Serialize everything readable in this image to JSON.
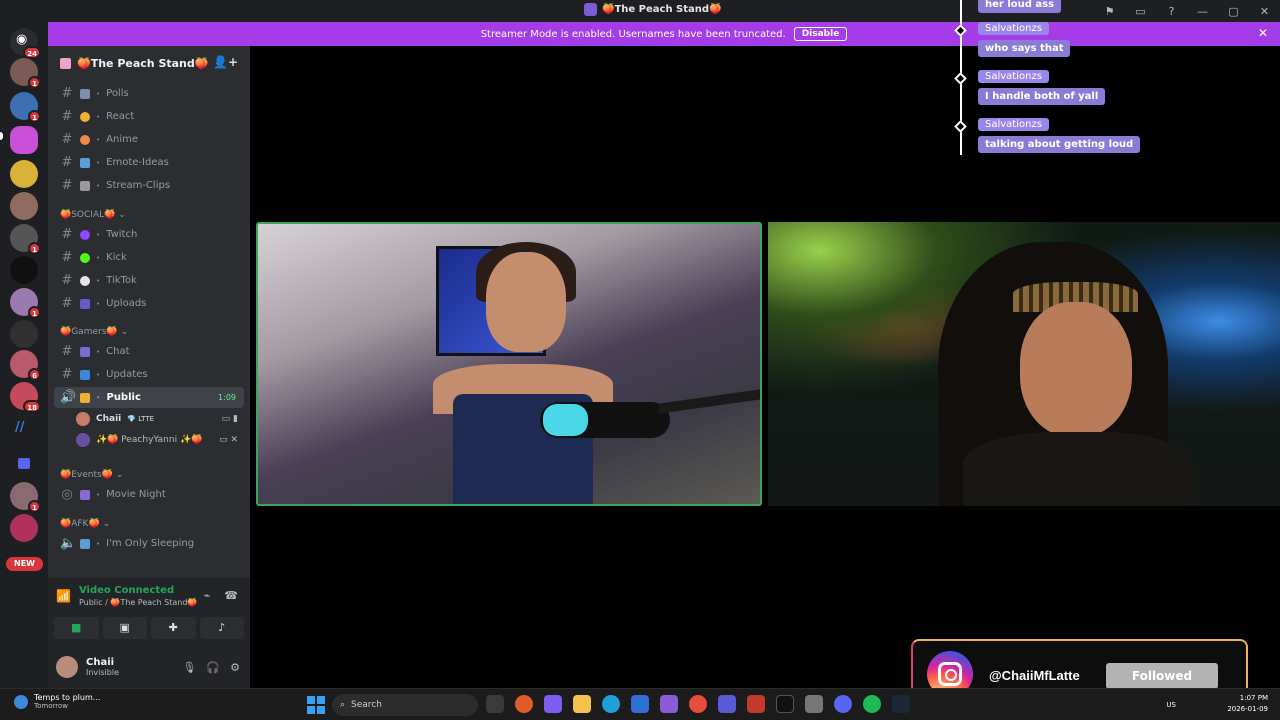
{
  "window": {
    "title": "🍑The Peach Stand🍑"
  },
  "banner": {
    "text": "Streamer Mode is enabled. Usernames have been truncated.",
    "disable_label": "Disable"
  },
  "rail": {
    "home_badge": "24",
    "badges": [
      "1",
      "1",
      "1",
      "1",
      "1",
      "6",
      "18",
      "1"
    ],
    "new_label": "NEW"
  },
  "guild": {
    "name": "🍑The Peach Stand🍑"
  },
  "channels_top": [
    {
      "name": "Polls"
    },
    {
      "name": "React"
    },
    {
      "name": "Anime"
    },
    {
      "name": "Emote-Ideas"
    },
    {
      "name": "Stream-Clips"
    }
  ],
  "categories": {
    "social": "🍑SOCIAL🍑",
    "gamers": "🍑Gamers🍑",
    "events": "🍑Events🍑",
    "afk": "🍑AFK🍑"
  },
  "channels_social": [
    {
      "name": "Twitch"
    },
    {
      "name": "Kick"
    },
    {
      "name": "TikTok"
    },
    {
      "name": "Uploads"
    }
  ],
  "channels_gamers": [
    {
      "name": "Chat"
    },
    {
      "name": "Updates"
    }
  ],
  "voice_public": {
    "name": "Public",
    "time": "1:09",
    "users": [
      {
        "name": "Chaii",
        "tag": "💎 LTTE"
      },
      {
        "name": "✨🍑 PeachyYanni ✨🍑",
        "tag": ""
      }
    ]
  },
  "events_channel": "Movie Night",
  "afk_channel": "I'm Only Sleeping",
  "voice_panel": {
    "status": "Video Connected",
    "location": "Public / 🍑The Peach Stand🍑"
  },
  "user_panel": {
    "name": "Chaii",
    "status": "Invisible"
  },
  "chat_overlay": [
    {
      "user": "",
      "text": "her loud ass"
    },
    {
      "user": "Salvationzs",
      "text": "who says that"
    },
    {
      "user": "Salvationzs",
      "text": "I handle both of yall"
    },
    {
      "user": "Salvationzs",
      "text": "talking about getting loud"
    }
  ],
  "instagram_card": {
    "handle": "@ChaiiMfLatte",
    "button": "Followed"
  },
  "taskbar": {
    "weather_line1": "Temps to plum...",
    "weather_line2": "Tomorrow",
    "search_placeholder": "Search",
    "lang": "US",
    "time": "1:07 PM",
    "date": "2026-01-09"
  },
  "colors": {
    "accent_purple": "#a43de8",
    "speaking_green": "#3ba55c",
    "chat_bubble": "#8b7bd6"
  }
}
